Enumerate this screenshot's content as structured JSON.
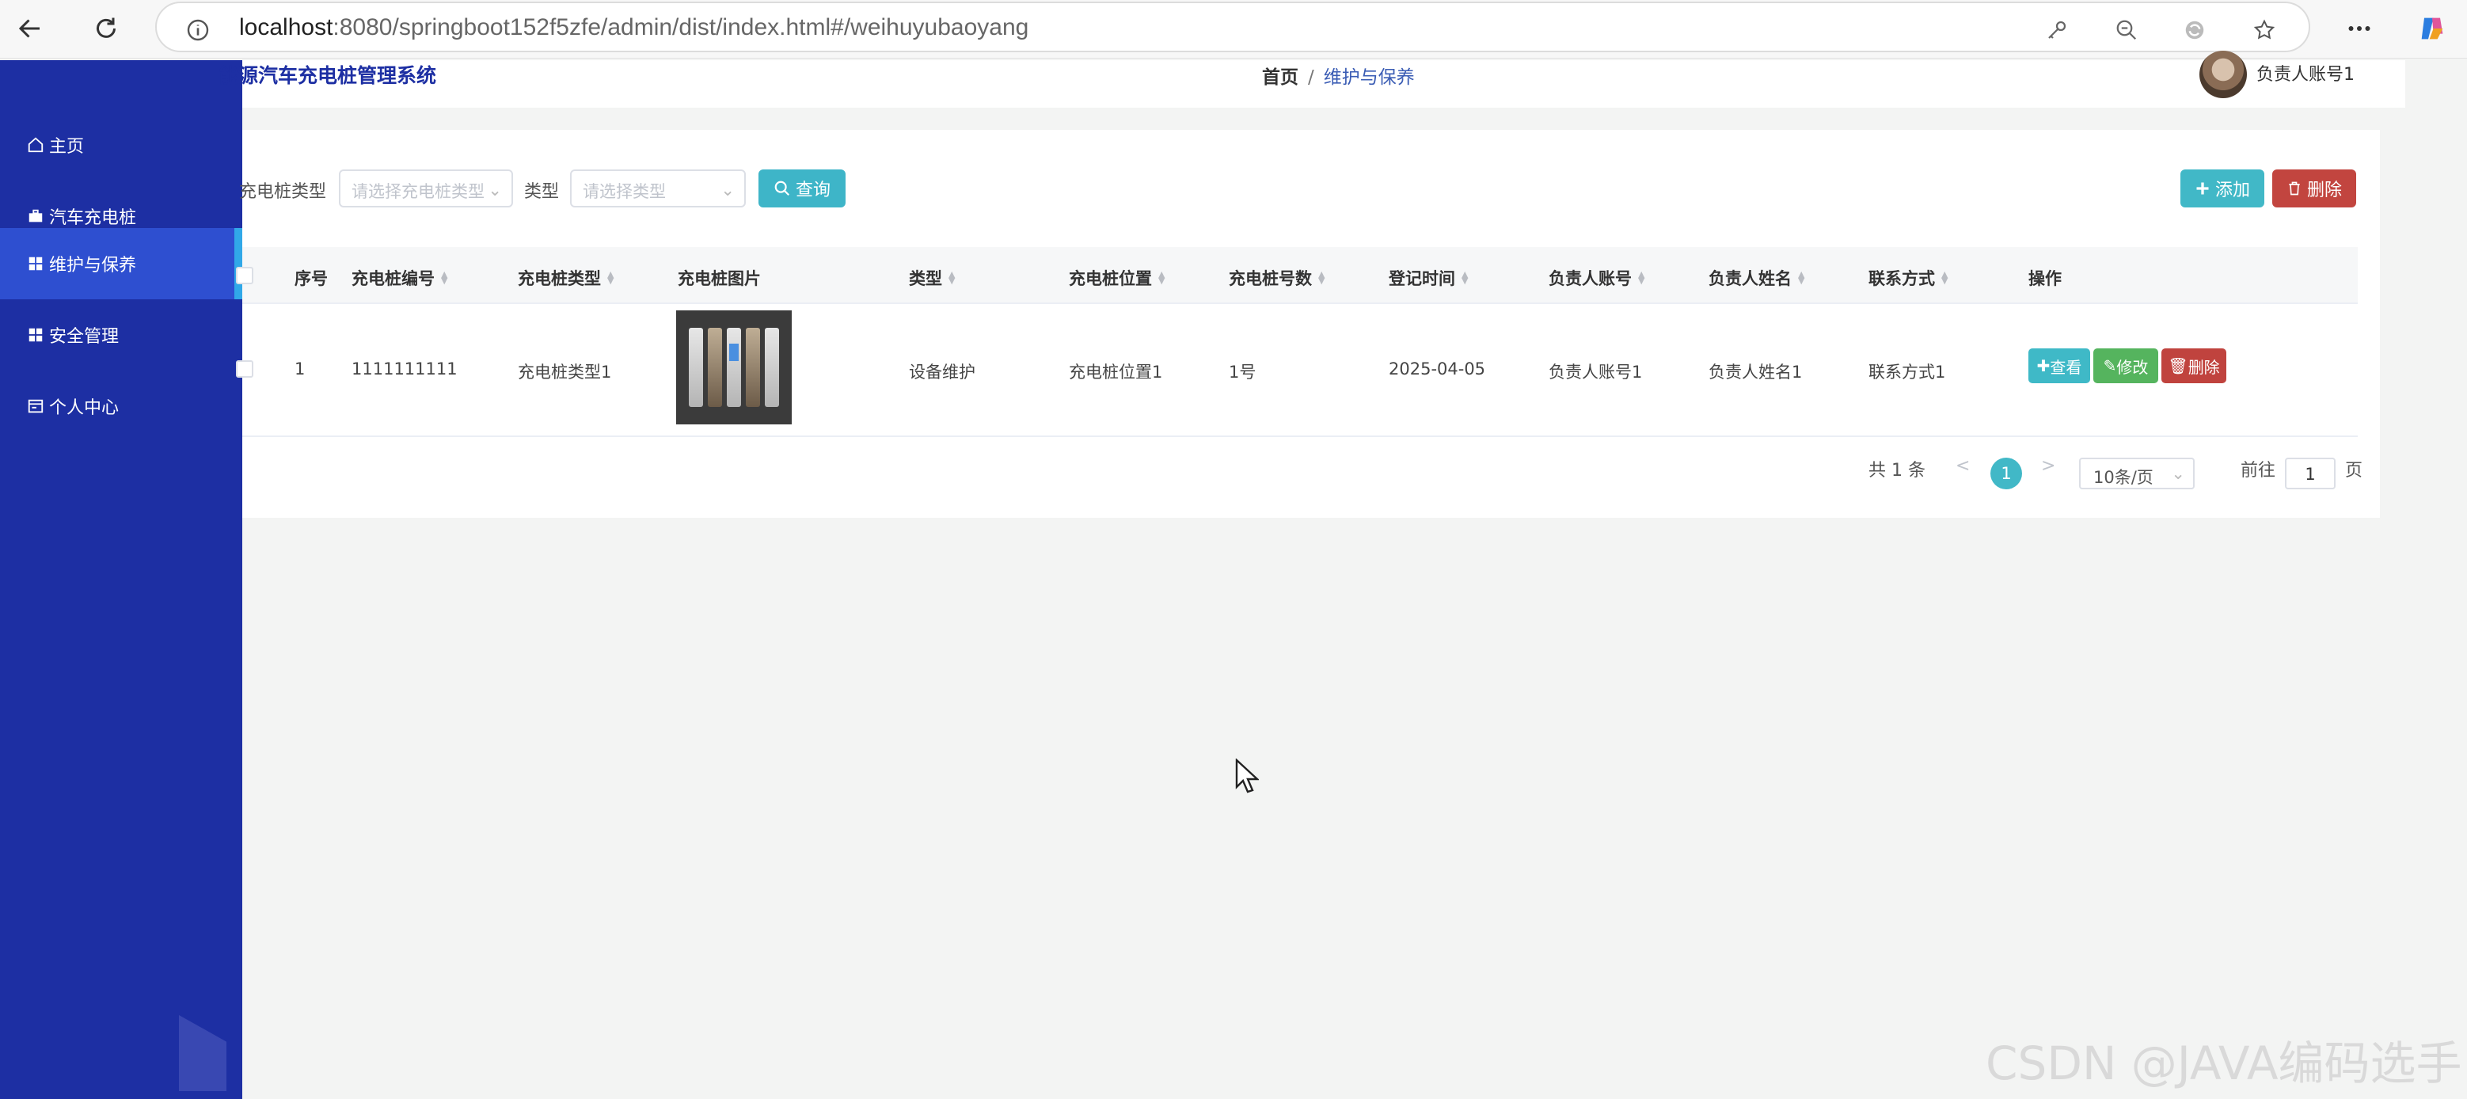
{
  "browser": {
    "url_host": "localhost",
    "url_rest": ":8080/springboot152f5zfe/admin/dist/index.html#/weihuyubaoyang"
  },
  "header": {
    "system_title": "能源汽车充电桩管理系统",
    "breadcrumb_home": "首页",
    "breadcrumb_sep": "/",
    "breadcrumb_current": "维护与保养",
    "user_name": "负责人账号1"
  },
  "sidebar": {
    "items": [
      {
        "label": "主页",
        "icon": "home-icon"
      },
      {
        "label": "汽车充电桩",
        "icon": "briefcase-icon"
      },
      {
        "label": "维护与保养",
        "icon": "grid-icon",
        "active": true
      },
      {
        "label": "安全管理",
        "icon": "grid-icon"
      },
      {
        "label": "个人中心",
        "icon": "card-icon"
      }
    ]
  },
  "filters": {
    "type_label": "充电桩类型",
    "type_placeholder": "请选择充电桩类型",
    "kind_label": "类型",
    "kind_placeholder": "请选择类型",
    "search_button": "查询"
  },
  "toolbar": {
    "add_button": "添加",
    "delete_button": "删除"
  },
  "table": {
    "columns": [
      "序号",
      "充电桩编号",
      "充电桩类型",
      "充电桩图片",
      "类型",
      "充电桩位置",
      "充电桩号数",
      "登记时间",
      "负责人账号",
      "负责人姓名",
      "联系方式",
      "操作"
    ],
    "rows": [
      {
        "index": "1",
        "code": "1111111111",
        "pile_type": "充电桩类型1",
        "kind": "设备维护",
        "location": "充电桩位置1",
        "pile_no": "1号",
        "date": "2025-04-05",
        "account": "负责人账号1",
        "name": "负责人姓名1",
        "contact": "联系方式1",
        "actions": {
          "view": "查看",
          "edit": "修改",
          "delete": "删除"
        }
      }
    ]
  },
  "pagination": {
    "total": "共 1 条",
    "prev": "<",
    "current": "1",
    "next": ">",
    "page_size": "10条/页",
    "goto_label": "前往",
    "goto_value": "1",
    "page_suffix": "页"
  },
  "watermark": "CSDN @JAVA编码选手"
}
